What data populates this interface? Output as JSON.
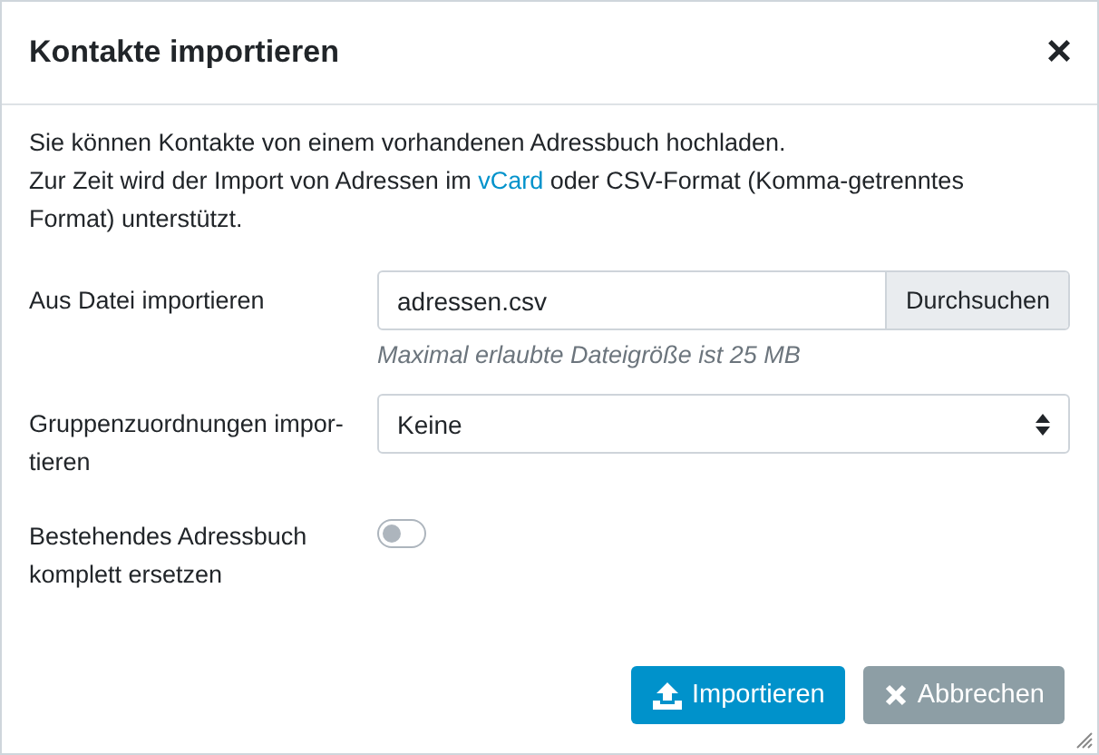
{
  "dialog": {
    "title": "Kontakte importieren",
    "close": "×"
  },
  "intro": {
    "line1": "Sie können Kontakte von einem vorhandenen Adressbuch hochladen.",
    "line2_before": "Zur Zeit wird der Import von Adressen im ",
    "link": "vCard",
    "line2_after": " oder CSV-Format (Komma-getrenntes Format) unterstützt."
  },
  "fields": [
    {
      "kind": "file",
      "label": "Aus Datei importieren",
      "value": "adressen.csv",
      "button": "Durchsuchen",
      "hint": "Maximal erlaubte Dateigröße ist 25 MB"
    },
    {
      "kind": "select",
      "label": "Gruppenzuordnungen impor-tieren",
      "value": "Keine"
    },
    {
      "kind": "toggle",
      "label": "Bestehendes Adressbuch komplett ersetzen",
      "on": false
    }
  ],
  "buttons": [
    {
      "kind": "primary",
      "label": "Importieren"
    },
    {
      "kind": "secondary",
      "label": "Abbrechen"
    }
  ]
}
